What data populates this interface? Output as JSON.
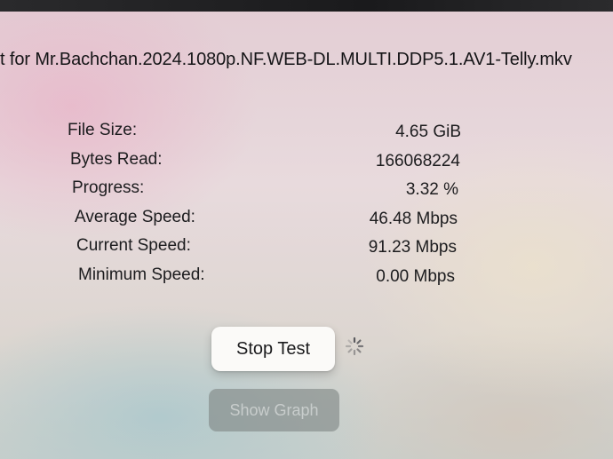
{
  "screen": {
    "title": "t for Mr.Bachchan.2024.1080p.NF.WEB-DL.MULTI.DDP5.1.AV1-Telly.mkv"
  },
  "stats": [
    {
      "label": "File Size:",
      "value": "4.65 GiB"
    },
    {
      "label": "Bytes Read:",
      "value": "166068224"
    },
    {
      "label": "Progress:",
      "value": "3.32 %"
    },
    {
      "label": "Average Speed:",
      "value": "46.48 Mbps"
    },
    {
      "label": "Current Speed:",
      "value": "91.23 Mbps"
    },
    {
      "label": "Minimum Speed:",
      "value": "0.00 Mbps"
    }
  ],
  "actions": {
    "stop_label": "Stop Test",
    "graph_label": "Show Graph",
    "graph_enabled": false,
    "activity_icon": "activity-spinner-icon"
  },
  "colors": {
    "text": "#1c1c1e",
    "button_bg": "#fbfaf8",
    "disabled_button_bg": "#808684"
  }
}
